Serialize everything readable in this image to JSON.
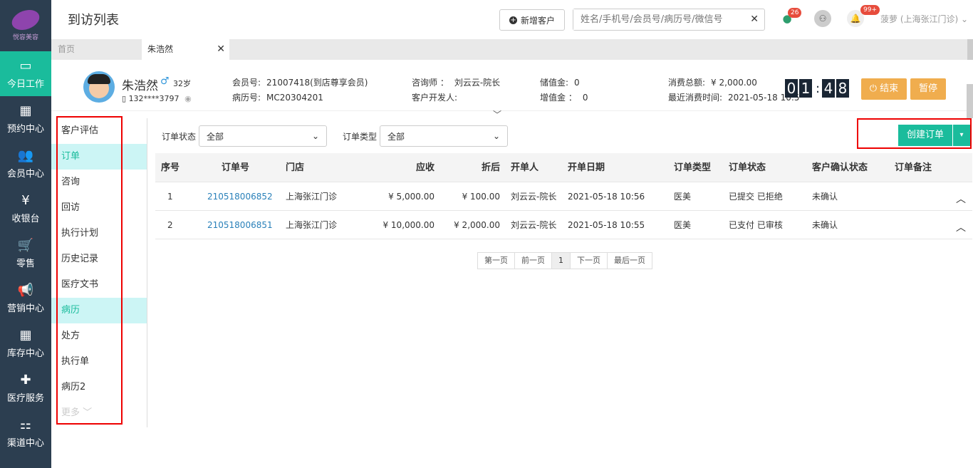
{
  "sidebar": {
    "logo_text": "悦容美容",
    "items": [
      {
        "label": "今日工作",
        "icon": "▭",
        "icon_name": "monitor-icon",
        "active": true
      },
      {
        "label": "预约中心",
        "icon": "▦",
        "icon_name": "calendar-icon"
      },
      {
        "label": "会员中心",
        "icon": "👥",
        "icon_name": "users-icon"
      },
      {
        "label": "收银台",
        "icon": "¥",
        "icon_name": "yen-icon"
      },
      {
        "label": "零售",
        "icon": "🛒",
        "icon_name": "cart-icon"
      },
      {
        "label": "营销中心",
        "icon": "📢",
        "icon_name": "megaphone-icon"
      },
      {
        "label": "库存中心",
        "icon": "▦",
        "icon_name": "grid-icon"
      },
      {
        "label": "医疗服务",
        "icon": "✚",
        "icon_name": "medkit-icon"
      },
      {
        "label": "渠道中心",
        "icon": "⚏",
        "icon_name": "sitemap-icon"
      }
    ]
  },
  "topbar": {
    "title": "到访列表",
    "add_customer": "新增客户",
    "search_placeholder": "姓名/手机号/会员号/病历号/微信号",
    "badge_wechat": "26",
    "badge_notify": "99+",
    "user": "菠萝 (上海张江门诊)"
  },
  "tabs": {
    "home": "首页",
    "current": "朱浩然"
  },
  "patient": {
    "name": "朱浩然",
    "gender": "♂",
    "age": "32岁",
    "phone": "132****3797",
    "member_label": "会员号:",
    "member_no": "21007418(到店尊享会员)",
    "record_label": "病历号:",
    "record_no": "MC20304201",
    "consultant_label": "咨询师 ：",
    "consultant": "刘云云-院长",
    "developer_label": "客户开发人:",
    "stored_label": "储值金:",
    "stored": "0",
    "bonus_label": "增值金 ：",
    "bonus": "0",
    "total_label": "消费总额:",
    "total": "¥ 2,000.00",
    "last_label": "最近消费时间:",
    "last": "2021-05-18 10:5"
  },
  "timer": {
    "d1": "0",
    "d2": "1",
    "d3": "4",
    "d4": "8"
  },
  "actions": {
    "end": "结束",
    "pause": "暂停"
  },
  "menu": {
    "items": [
      "客户评估",
      "订单",
      "咨询",
      "回访",
      "执行计划",
      "历史记录",
      "医疗文书",
      "病历",
      "处方",
      "执行单",
      "病历2"
    ],
    "more": "更多"
  },
  "filters": {
    "status_label": "订单状态",
    "status_value": "全部",
    "type_label": "订单类型",
    "type_value": "全部"
  },
  "create_order": "创建订单",
  "table": {
    "headers": [
      "序号",
      "订单号",
      "门店",
      "应收",
      "折后",
      "开单人",
      "开单日期",
      "订单类型",
      "订单状态",
      "客户确认状态",
      "订单备注"
    ],
    "rows": [
      {
        "no": "1",
        "order": "210518006852",
        "store": "上海张江门诊",
        "due": "¥ 5,000.00",
        "disc": "¥ 100.00",
        "opener": "刘云云-院长",
        "date": "2021-05-18 10:56",
        "type": "医美",
        "status": "已提交  已拒绝",
        "confirm": "未确认"
      },
      {
        "no": "2",
        "order": "210518006851",
        "store": "上海张江门诊",
        "due": "¥ 10,000.00",
        "disc": "¥ 2,000.00",
        "opener": "刘云云-院长",
        "date": "2021-05-18 10:55",
        "type": "医美",
        "status": "已支付  已审核",
        "confirm": "未确认"
      }
    ]
  },
  "pager": {
    "first": "第一页",
    "prev": "前一页",
    "page": "1",
    "next": "下一页",
    "last": "最后一页"
  }
}
